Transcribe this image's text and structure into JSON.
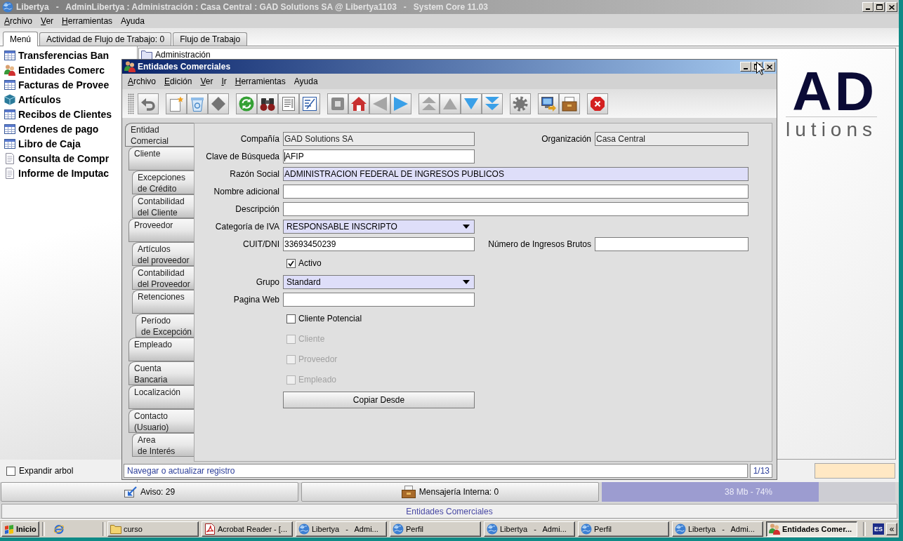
{
  "main_window": {
    "title": "Libertya   -   AdminLibertya : Administración : Casa Central : GAD Solutions SA @ Libertya1103   -   System Core 11.03",
    "menu": [
      {
        "label": "Archivo",
        "mnemonic": true
      },
      {
        "label": "Ver",
        "mnemonic": true
      },
      {
        "label": "Herramientas",
        "mnemonic": true
      },
      {
        "label": "Ayuda",
        "mnemonic": false
      }
    ],
    "tabs": [
      {
        "label": "Menú",
        "selected": true
      },
      {
        "label": "Actividad de Flujo de Trabajo: 0",
        "selected": false
      },
      {
        "label": "Flujo de Trabajo",
        "selected": false
      }
    ],
    "menu_items": [
      {
        "kind": "window",
        "label": "Transferencias Ban"
      },
      {
        "kind": "entities",
        "label": "Entidades Comerc"
      },
      {
        "kind": "window",
        "label": "Facturas de Provee"
      },
      {
        "kind": "product",
        "label": "Artículos"
      },
      {
        "kind": "window",
        "label": "Recibos de Clientes"
      },
      {
        "kind": "window",
        "label": "Ordenes de pago"
      },
      {
        "kind": "window",
        "label": "Libro de Caja"
      },
      {
        "kind": "report",
        "label": "Consulta de Compr"
      },
      {
        "kind": "report",
        "label": "Informe de Imputac"
      }
    ],
    "expand_tree": {
      "label": "Expandir arbol",
      "checked": false
    },
    "tree": [
      {
        "label": "Administración"
      }
    ],
    "logo": {
      "wordmark": "AD",
      "tagline": "lutions"
    },
    "status_bar": {
      "notices": "Aviso: 29",
      "messages": "Mensajería Interna: 0",
      "memory": {
        "level": 0.74,
        "reading": "38 Mb - 74%"
      }
    },
    "footer": "Entidades Comerciales"
  },
  "child_window": {
    "title": "Entidades Comerciales",
    "menu": [
      {
        "label": "Archivo",
        "mnemonic": true
      },
      {
        "label": "Edición",
        "mnemonic": true
      },
      {
        "label": "Ver",
        "mnemonic": true
      },
      {
        "label": "Ir",
        "mnemonic": true
      },
      {
        "label": "Herramientas",
        "mnemonic": true
      },
      {
        "label": "Ayuda",
        "mnemonic": false
      }
    ],
    "toolbar": [
      [
        {
          "kind": "undo",
          "disabled": true
        }
      ],
      [
        {
          "kind": "new",
          "disabled": false
        },
        {
          "kind": "delete",
          "disabled": false
        },
        {
          "kind": "diamond",
          "disabled": true
        }
      ],
      [
        {
          "kind": "refresh",
          "disabled": false
        },
        {
          "kind": "find",
          "disabled": false
        },
        {
          "kind": "report",
          "disabled": false
        },
        {
          "kind": "form",
          "disabled": false
        }
      ],
      [
        {
          "kind": "square",
          "disabled": true
        },
        {
          "kind": "home",
          "disabled": false
        },
        {
          "kind": "previous",
          "disabled": true
        },
        {
          "kind": "next",
          "disabled": false
        }
      ],
      [
        {
          "kind": "first",
          "disabled": true
        },
        {
          "kind": "up",
          "disabled": true
        },
        {
          "kind": "down",
          "disabled": false
        },
        {
          "kind": "last",
          "disabled": false
        }
      ],
      [
        {
          "kind": "gear",
          "disabled": true
        }
      ],
      [
        {
          "kind": "monitor",
          "disabled": false
        },
        {
          "kind": "archive",
          "disabled": false
        }
      ],
      [
        {
          "kind": "close",
          "disabled": false
        }
      ]
    ],
    "tabs": [
      {
        "label": "Entidad\nComercial",
        "selected": true,
        "children": [
          {
            "label": "Cliente",
            "selected": false,
            "children": [
              {
                "label": "Excepciones\nde Crédito",
                "selected": false
              },
              {
                "label": "Contabilidad\ndel Cliente",
                "selected": false
              }
            ]
          },
          {
            "label": "Proveedor",
            "selected": false,
            "children": [
              {
                "label": "Artículos\ndel proveedor",
                "selected": false
              },
              {
                "label": "Contabilidad\ndel Proveedor",
                "selected": false
              },
              {
                "label": "Retenciones",
                "selected": false,
                "children": [
                  {
                    "label": "Período\nde Excepción",
                    "selected": false
                  }
                ]
              }
            ]
          },
          {
            "label": "Empleado",
            "selected": false
          },
          {
            "label": "Cuenta\nBancaria",
            "selected": false
          },
          {
            "label": "Localización",
            "selected": false
          },
          {
            "label": "Contacto\n(Usuario)",
            "selected": false,
            "children": [
              {
                "label": "Area\nde Interés",
                "selected": false
              }
            ]
          }
        ]
      }
    ],
    "form": {
      "rows": [
        [
          {
            "kind": "text",
            "label": "Compañía",
            "value": "GAD Solutions SA",
            "read_only": true,
            "mandatory": false,
            "focused": false,
            "wide": false
          },
          {
            "kind": "text",
            "label": "Organización",
            "value": "Casa Central",
            "read_only": true,
            "mandatory": false,
            "focused": false,
            "wide": false
          }
        ],
        [
          {
            "kind": "text",
            "label": "Clave de Búsqueda",
            "value": "AFIP",
            "read_only": false,
            "mandatory": false,
            "focused": true,
            "wide": false
          }
        ],
        [
          {
            "kind": "text",
            "label": "Razón Social",
            "value": "ADMINISTRACION FEDERAL DE INGRESOS PUBLICOS",
            "read_only": false,
            "mandatory": true,
            "focused": false,
            "wide": true
          }
        ],
        [
          {
            "kind": "text",
            "label": "Nombre adicional",
            "read_only": false,
            "mandatory": false,
            "focused": false,
            "wide": true
          }
        ],
        [
          {
            "kind": "text",
            "label": "Descripción",
            "read_only": false,
            "mandatory": false,
            "focused": false,
            "wide": true
          }
        ],
        [
          {
            "kind": "combo",
            "label": "Categoría de IVA",
            "value": "RESPONSABLE INSCRIPTO",
            "mandatory": true,
            "wide": false
          }
        ],
        [
          {
            "kind": "text",
            "label": "CUIT/DNI",
            "value": "33693450239",
            "read_only": false,
            "mandatory": false,
            "focused": false,
            "wide": false
          },
          {
            "kind": "text",
            "label": "Número de Ingresos Brutos",
            "read_only": false,
            "mandatory": false,
            "focused": false,
            "wide": false
          }
        ],
        [
          {
            "kind": "checkbox",
            "label": "Activo",
            "checked": true,
            "disabled": false
          }
        ],
        [
          {
            "kind": "combo",
            "label": "Grupo",
            "value": "Standard",
            "mandatory": true,
            "wide": false
          }
        ],
        [
          {
            "kind": "text",
            "label": "Pagina Web",
            "read_only": false,
            "mandatory": false,
            "focused": false,
            "wide": false
          }
        ],
        [
          {
            "kind": "checkbox",
            "label": "Cliente Potencial",
            "checked": false,
            "disabled": false
          }
        ],
        [
          {
            "kind": "checkbox",
            "label": "Cliente",
            "checked": false,
            "disabled": true
          }
        ],
        [
          {
            "kind": "checkbox",
            "label": "Proveedor",
            "checked": false,
            "disabled": true
          }
        ],
        [
          {
            "kind": "checkbox",
            "label": "Empleado",
            "checked": false,
            "disabled": true
          }
        ],
        [
          {
            "kind": "button",
            "label": "Copiar Desde"
          }
        ]
      ]
    },
    "status_bar": {
      "message": "Navegar o actualizar registro",
      "record": "1/13"
    }
  },
  "taskbar": {
    "start": "Inicio",
    "tasks": [
      {
        "kind": "folder",
        "label": "curso",
        "selected": false
      },
      {
        "kind": "document",
        "label": "Acrobat Reader - [...",
        "selected": false
      },
      {
        "kind": "globe",
        "label": "Libertya   -   Admi...",
        "selected": false
      },
      {
        "kind": "globe",
        "label": "Perfil",
        "selected": false
      },
      {
        "kind": "globe",
        "label": "Libertya   -   Admi...",
        "selected": false
      },
      {
        "kind": "globe",
        "label": "Perfil",
        "selected": false
      },
      {
        "kind": "globe",
        "label": "Libertya   -   Admi...",
        "selected": false
      },
      {
        "kind": "people",
        "label": "Entidades Comer...",
        "selected": true
      }
    ],
    "language": "ES",
    "tray_toggle": "«"
  }
}
